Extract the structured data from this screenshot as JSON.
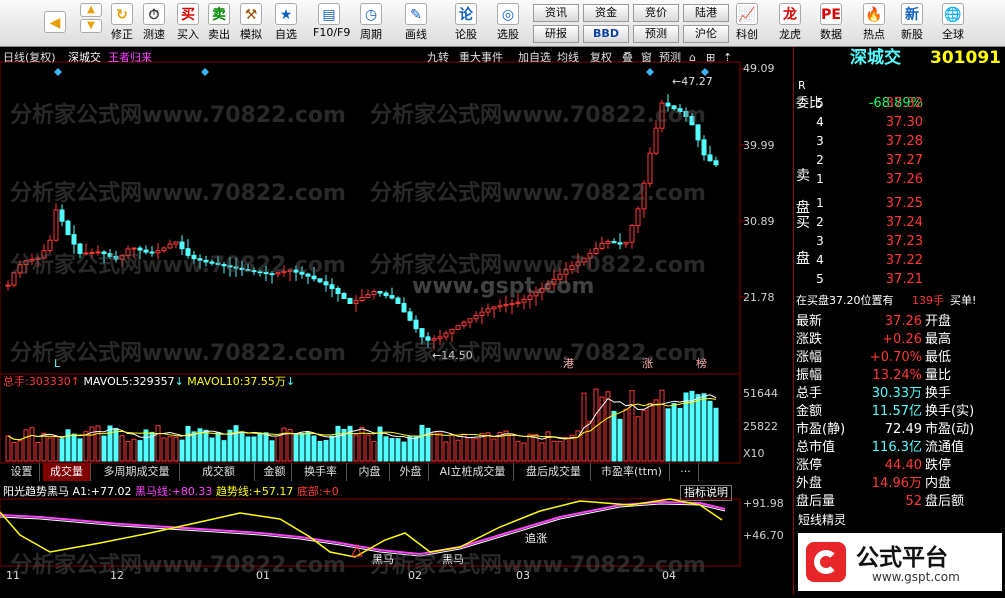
{
  "toolbar": {
    "buttons": [
      {
        "label": "修正"
      },
      {
        "label": "测速"
      },
      {
        "label": "买入",
        "glyph": "买"
      },
      {
        "label": "卖出",
        "glyph": "卖"
      },
      {
        "label": "模拟"
      },
      {
        "label": "自选"
      },
      {
        "label": "F10/F9"
      },
      {
        "label": "周期"
      },
      {
        "label": "画线"
      },
      {
        "label": "论股"
      },
      {
        "label": "选股"
      },
      {
        "label": "科创"
      },
      {
        "label": "龙虎"
      },
      {
        "label": "数据"
      },
      {
        "label": "热点"
      },
      {
        "label": "新股"
      },
      {
        "label": "全球"
      }
    ],
    "info_buttons": [
      "资讯",
      "资金",
      "竞价",
      "陆港",
      "研报",
      "BBD",
      "预测",
      "沪伦"
    ],
    "icons": [
      "left-arrow-icon",
      "up-arrow-icon",
      "down-arrow-icon",
      "refresh-icon",
      "clock-icon",
      "buy-icon",
      "sell-icon",
      "hammer-icon",
      "star-icon",
      "f10-icon",
      "cycle-icon",
      "pencil-icon",
      "forum-icon",
      "stock-picker-icon",
      "chart-icon",
      "tiger-icon",
      "pe-icon",
      "hot-icon",
      "new-stock-icon",
      "globe-icon"
    ]
  },
  "chart_header": {
    "mode": "日线(复权)",
    "name": "深城交",
    "tag": "王者归来",
    "buttons": [
      "九转",
      "重大事件",
      "加自选",
      "均线",
      "复权",
      "叠",
      "窗",
      "预测"
    ]
  },
  "watermarks": [
    "分析家公式网www.70822.com",
    "www.gspt.com"
  ],
  "kline": {
    "max_label": "47.27",
    "min_label": "14.50",
    "markers": [
      "L",
      "港",
      "涨",
      "榜"
    ],
    "y_ticks": [
      "49.09",
      "39.99",
      "30.89",
      "21.78"
    ]
  },
  "volume": {
    "label": "总手:",
    "total": "303330",
    "mavol5_label": "MAVOL5:",
    "mavol5": "329357",
    "mavol10_label": "MAVOL10:",
    "mavol10": "37.55万",
    "y_ticks": [
      "51644",
      "25822",
      "X10"
    ]
  },
  "tabs": [
    "设置",
    "成交量",
    "多周期成交量",
    "成交额",
    "金额",
    "换手率",
    "内盘",
    "外盘",
    "AI立桩成交量",
    "盘后成交量",
    "市盈率(ttm)",
    "···"
  ],
  "indicator": {
    "name": "阳光趋势黑马",
    "a1_label": "A1:",
    "a1": "+77.02",
    "hm_label": "黑马线:",
    "hm": "+80.33",
    "trend_label": "趋势线:",
    "trend": "+57.17",
    "bottom_label": "底部:",
    "bottom": "+0",
    "help": "指标说明",
    "y_ticks": [
      "+91.98",
      "+46.70"
    ],
    "notes": [
      "追涨",
      "黑马",
      "黑马"
    ]
  },
  "x_axis": [
    "11",
    "12",
    "01",
    "02",
    "03",
    "04"
  ],
  "quote": {
    "title": "深城交",
    "code": "301091",
    "r_label": "R",
    "webi_label": "委比",
    "webi": "-68.89%",
    "sell_label": [
      "卖",
      "盘"
    ],
    "buy_label": [
      "买",
      "盘"
    ],
    "sell": [
      {
        "level": "5",
        "price": "37.32"
      },
      {
        "level": "4",
        "price": "37.30"
      },
      {
        "level": "3",
        "price": "37.28"
      },
      {
        "level": "2",
        "price": "37.27"
      },
      {
        "level": "1",
        "price": "37.26"
      }
    ],
    "buy": [
      {
        "level": "1",
        "price": "37.25"
      },
      {
        "level": "2",
        "price": "37.24"
      },
      {
        "level": "3",
        "price": "37.23"
      },
      {
        "level": "4",
        "price": "37.22"
      },
      {
        "level": "5",
        "price": "37.21"
      }
    ],
    "notice": "在买盘37.20位置有",
    "notice_amt": "139手",
    "notice_tag": "买单!",
    "stats": [
      {
        "l1": "最新",
        "v1": "37.26",
        "l2": "开盘"
      },
      {
        "l1": "涨跌",
        "v1": "+0.26",
        "l2": "最高"
      },
      {
        "l1": "涨幅",
        "v1": "+0.70%",
        "l2": "最低"
      },
      {
        "l1": "振幅",
        "v1": "13.24%",
        "l2": "量比"
      },
      {
        "l1": "总手",
        "v1": "30.33万",
        "l2": "换手"
      },
      {
        "l1": "金额",
        "v1": "11.57亿",
        "l2": "换手(实)"
      },
      {
        "l1": "市盈(静)",
        "v1": "72.49",
        "l2": "市盈(动)"
      },
      {
        "l1": "总市值",
        "v1": "116.3亿",
        "l2": "流通值"
      },
      {
        "l1": "涨停",
        "v1": "44.40",
        "l2": "跌停"
      },
      {
        "l1": "外盘",
        "v1": "14.96万",
        "l2": "内盘"
      },
      {
        "l1": "盘后量",
        "v1": "52",
        "l2": "盘后额"
      }
    ],
    "short_title": "短线精灵",
    "logo_main": "公式平台",
    "logo_url": "www.gspt.com"
  },
  "colors": {
    "up": "#ff3838",
    "down": "#54ffff",
    "ma5": "#ffffff",
    "ma10": "#ffff00",
    "hm": "#ff00ff",
    "bg": "#000000"
  }
}
